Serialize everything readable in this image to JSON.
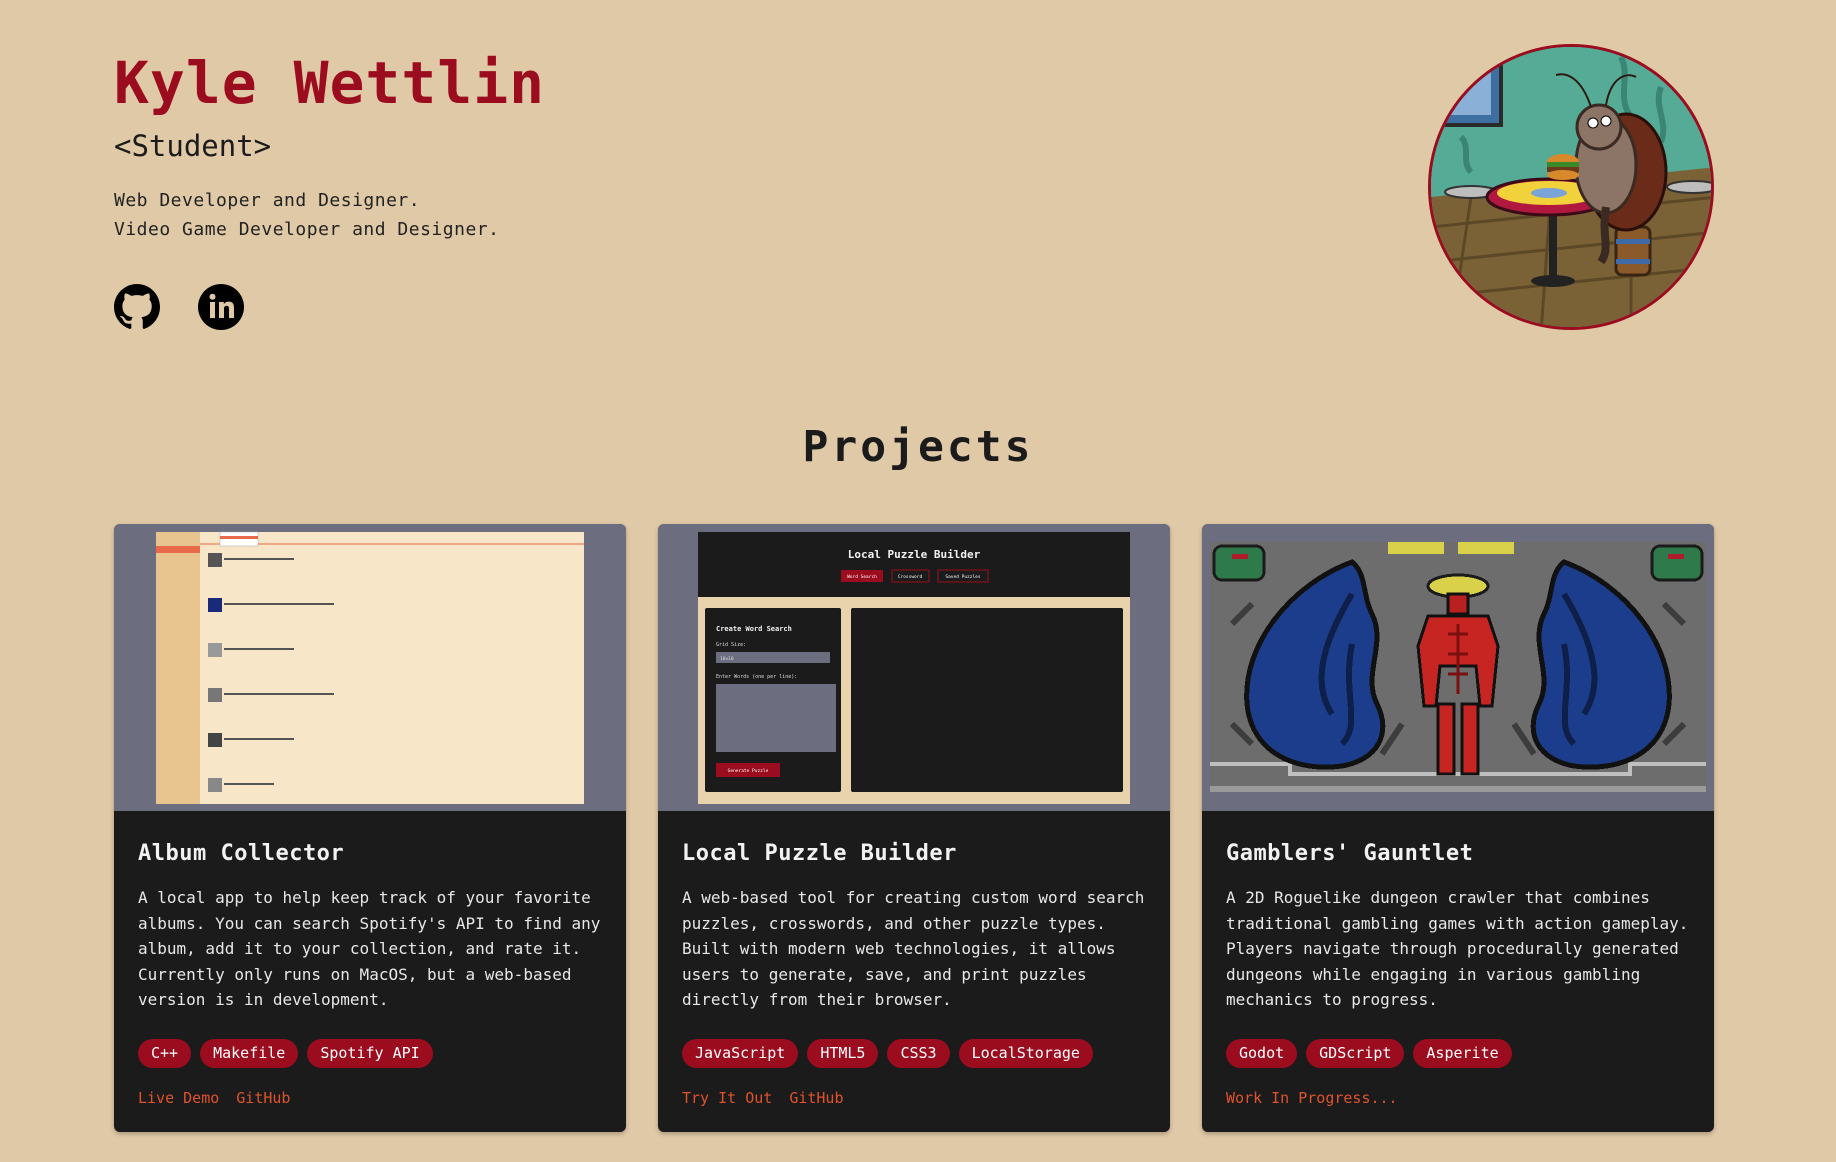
{
  "header": {
    "name": "Kyle Wettlin",
    "role": "<Student>",
    "taglines": [
      "Web Developer and Designer.",
      "Video Game Developer and Designer."
    ],
    "socials": [
      {
        "icon": "github-icon"
      },
      {
        "icon": "linkedin-icon"
      }
    ]
  },
  "projects": {
    "title": "Projects",
    "cards": [
      {
        "title": "Album Collector",
        "description": "A local app to help keep track of your favorite albums. You can search Spotify's API to find any album, add it to your collection, and rate it. Currently only runs on MacOS, but a web-based version is in development.",
        "tags": [
          "C++",
          "Makefile",
          "Spotify API"
        ],
        "links": [
          "Live Demo",
          "GitHub"
        ]
      },
      {
        "title": "Local Puzzle Builder",
        "description": "A web-based tool for creating custom word search puzzles, crosswords, and other puzzle types. Built with modern web technologies, it allows users to generate, save, and print puzzles directly from their browser.",
        "tags": [
          "JavaScript",
          "HTML5",
          "CSS3",
          "LocalStorage"
        ],
        "links": [
          "Try It Out",
          "GitHub"
        ],
        "preview": {
          "heading": "Local Puzzle Builder",
          "tabs": [
            "Word Search",
            "Crossword",
            "Saved Puzzles"
          ],
          "panel_title": "Create Word Search",
          "grid_label": "Grid Size:",
          "grid_value": "10x10",
          "words_label": "Enter Words (one per line):",
          "button": "Generate Puzzle"
        }
      },
      {
        "title": "Gamblers' Gauntlet",
        "description": "A 2D Roguelike dungeon crawler that combines traditional gambling games with action gameplay. Players navigate through procedurally generated dungeons while engaging in various gambling mechanics to progress.",
        "tags": [
          "Godot",
          "GDScript",
          "Asperite"
        ],
        "status": "Work In Progress..."
      }
    ]
  },
  "colors": {
    "background": "#e0c9a6",
    "accent": "#9b0c1f",
    "card": "#1b1b1c",
    "link": "#e0532a"
  }
}
